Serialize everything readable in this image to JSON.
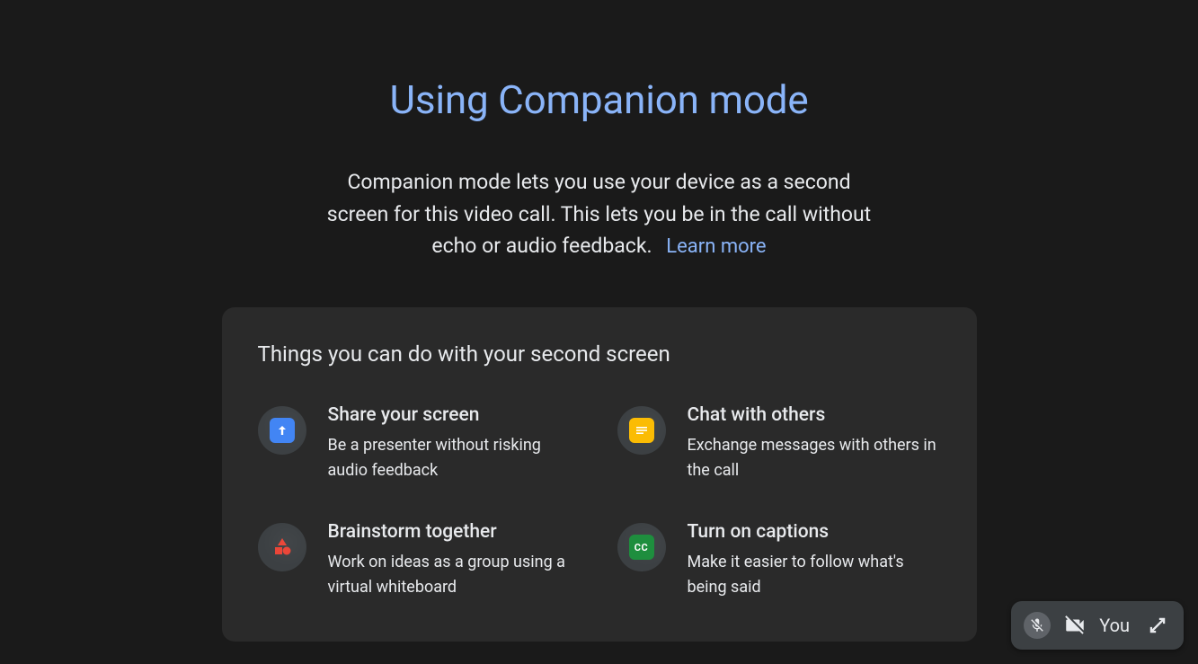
{
  "title": "Using Companion mode",
  "description": "Companion mode lets you use your device as a second screen for this video call. This lets you be in the call without echo or audio feedback.",
  "learn_more": "Learn more",
  "card": {
    "title": "Things you can do with your second screen",
    "features": [
      {
        "title": "Share your screen",
        "desc": "Be a presenter without risking audio feedback"
      },
      {
        "title": "Chat with others",
        "desc": "Exchange messages with others in the call"
      },
      {
        "title": "Brainstorm together",
        "desc": "Work on ideas as a group using a virtual whiteboard"
      },
      {
        "title": "Turn on captions",
        "desc": "Make it easier to follow what's being said"
      }
    ]
  },
  "self_view": {
    "label": "You",
    "cc_label": "CC"
  }
}
